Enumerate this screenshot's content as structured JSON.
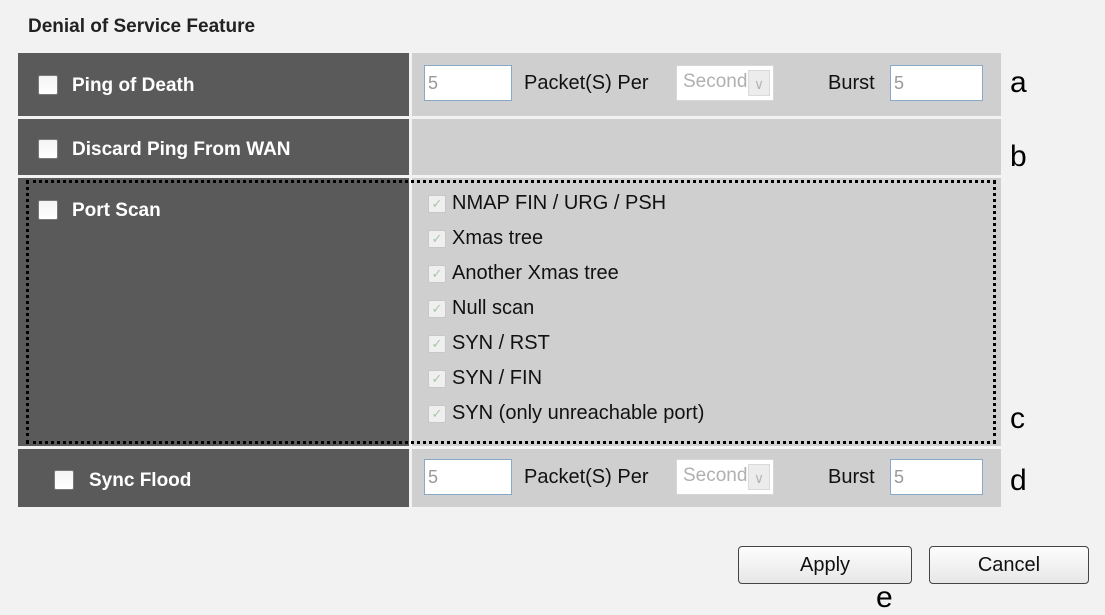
{
  "title": "Denial of Service Feature",
  "ping_of_death": {
    "label": "Ping of Death",
    "checked": false,
    "packets_value": "5",
    "packets_per_label": "Packet(S) Per",
    "unit_selected": "Second",
    "burst_label": "Burst",
    "burst_value": "5"
  },
  "discard_ping": {
    "label": "Discard Ping From WAN",
    "checked": false
  },
  "port_scan": {
    "label": "Port Scan",
    "checked": false,
    "options": [
      {
        "label": "NMAP FIN / URG / PSH",
        "checked": true
      },
      {
        "label": "Xmas tree",
        "checked": true
      },
      {
        "label": "Another Xmas tree",
        "checked": true
      },
      {
        "label": "Null scan",
        "checked": true
      },
      {
        "label": "SYN / RST",
        "checked": true
      },
      {
        "label": "SYN / FIN",
        "checked": true
      },
      {
        "label": "SYN (only unreachable port)",
        "checked": true
      }
    ]
  },
  "sync_flood": {
    "label": "Sync Flood",
    "checked": false,
    "packets_value": "5",
    "packets_per_label": "Packet(S) Per",
    "unit_selected": "Second",
    "burst_label": "Burst",
    "burst_value": "5"
  },
  "buttons": {
    "apply": "Apply",
    "cancel": "Cancel"
  },
  "markers": {
    "a": "a",
    "b": "b",
    "c": "c",
    "d": "d",
    "e": "e"
  }
}
